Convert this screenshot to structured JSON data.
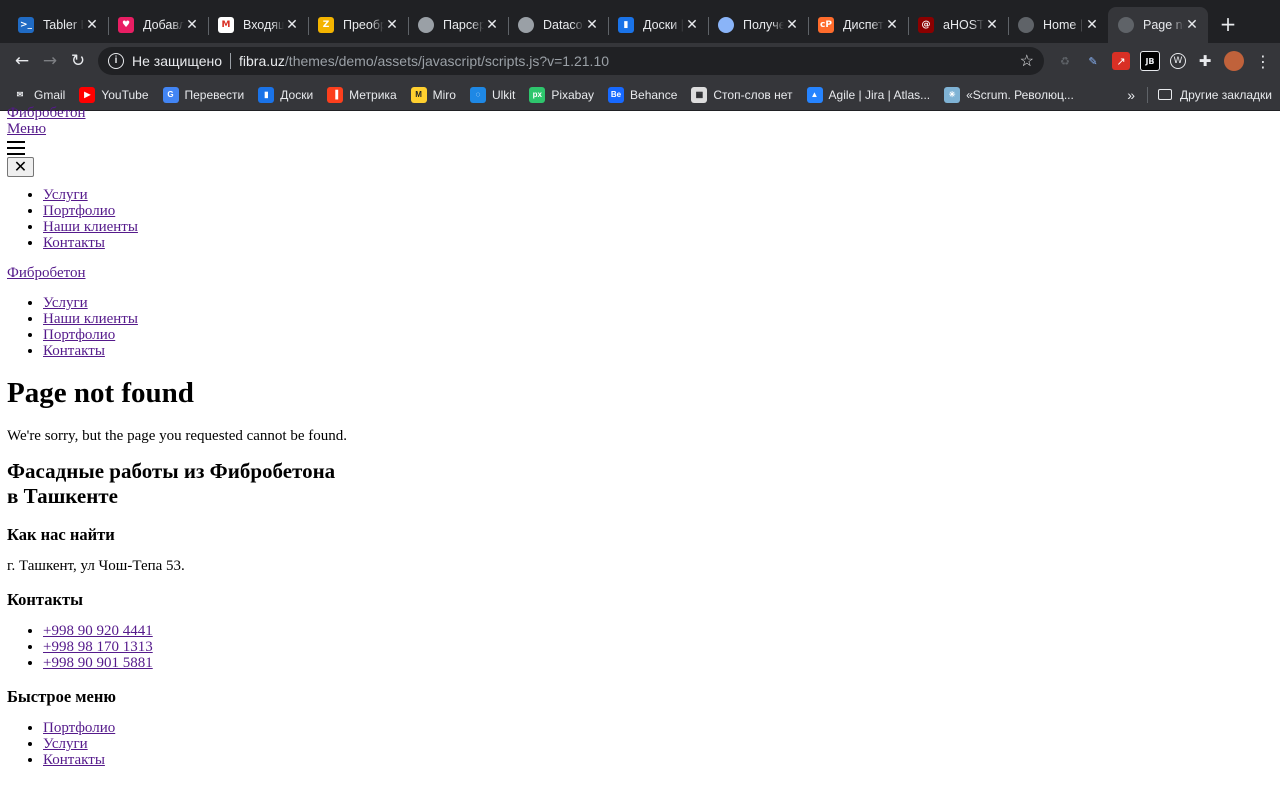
{
  "browser": {
    "tabs": [
      {
        "title": "Tabler Ic",
        "favicon": "tabler-icon",
        "color": "#206bc4",
        "glyph": ">_"
      },
      {
        "title": "Добавле",
        "favicon": "heart-icon",
        "color": "#e91e63",
        "glyph": "♥"
      },
      {
        "title": "Входящ",
        "favicon": "gmail-icon",
        "color": "#ffffff",
        "glyph": "M"
      },
      {
        "title": "Преобр",
        "favicon": "convert-icon",
        "color": "#f4b400",
        "glyph": "Z"
      },
      {
        "title": "Парсер",
        "favicon": "globe-icon",
        "color": "#9aa0a6",
        "glyph": ""
      },
      {
        "title": "Datacol",
        "favicon": "globe-icon",
        "color": "#9aa0a6",
        "glyph": ""
      },
      {
        "title": "Доски |",
        "favicon": "boards-icon",
        "color": "#1a73e8",
        "glyph": "▮"
      },
      {
        "title": "Получен",
        "favicon": "globe-icon",
        "color": "#8ab4f8",
        "glyph": ""
      },
      {
        "title": "Диспетч",
        "favicon": "cpanel-icon",
        "color": "#ff6c2c",
        "glyph": "cP"
      },
      {
        "title": "aHOST -",
        "favicon": "ahost-icon",
        "color": "#8b0000",
        "glyph": "@"
      },
      {
        "title": "Home |",
        "favicon": "globe-icon",
        "color": "#5f6368",
        "glyph": ""
      },
      {
        "title": "Page not",
        "favicon": "globe-icon",
        "color": "#5f6368",
        "glyph": "",
        "active": true
      }
    ],
    "security_label": "Не защищено",
    "url_host": "fibra.uz",
    "url_path": "/themes/demo/assets/javascript/scripts.js?v=1.21.10",
    "bookmarks": [
      {
        "label": "Gmail",
        "icon": "gmail-icon",
        "color": "#ffffff",
        "glyph": "✉"
      },
      {
        "label": "YouTube",
        "icon": "youtube-icon",
        "color": "#ff0000",
        "glyph": "▶"
      },
      {
        "label": "Перевести",
        "icon": "translate-icon",
        "color": "#4285f4",
        "glyph": "G"
      },
      {
        "label": "Доски",
        "icon": "boards-icon",
        "color": "#1a73e8",
        "glyph": "▮"
      },
      {
        "label": "Метрика",
        "icon": "metrika-icon",
        "color": "#fc3f1d",
        "glyph": "▐"
      },
      {
        "label": "Miro",
        "icon": "miro-icon",
        "color": "#ffd02f",
        "glyph": "M"
      },
      {
        "label": "Ulkit",
        "icon": "ulkit-icon",
        "color": "#1e88e5",
        "glyph": "◌"
      },
      {
        "label": "Pixabay",
        "icon": "pixabay-icon",
        "color": "#2ec66d",
        "glyph": "px"
      },
      {
        "label": "Behance",
        "icon": "behance-icon",
        "color": "#1769ff",
        "glyph": "Be"
      },
      {
        "label": "Стоп-слов нет",
        "icon": "grid-icon",
        "color": "#dddddd",
        "glyph": "▦"
      },
      {
        "label": "Agile | Jira | Atlas...",
        "icon": "atlassian-icon",
        "color": "#2684ff",
        "glyph": "▲"
      },
      {
        "label": "«Scrum. Революц...",
        "icon": "scrum-icon",
        "color": "#7fb3d5",
        "glyph": "✳"
      }
    ],
    "more_bookmarks": "»",
    "other_bookmarks": "Другие закладки"
  },
  "page": {
    "brand_link": "Фибробетон",
    "menu_link": "Меню",
    "close_glyph": "✕",
    "mobile_nav": [
      "Услуги",
      "Портфолио",
      "Наши клиенты",
      "Контакты"
    ],
    "brand_link_2": "Фибробетон",
    "main_nav": [
      "Услуги",
      "Наши клиенты",
      "Портфолио",
      "Контакты"
    ],
    "heading": "Page not found",
    "message": "We're sorry, but the page you requested cannot be found.",
    "footer_title_line1": "Фасадные работы из Фибробетона",
    "footer_title_line2": "в Ташкенте",
    "find_us_title": "Как нас найти",
    "address": "г. Ташкент, ул Чош-Тепа 53.",
    "contacts_title": "Контакты",
    "phones": [
      "+998 90 920 4441",
      "+998 98 170 1313",
      "+998 90 901 5881"
    ],
    "quick_menu_title": "Быстрое меню",
    "quick_menu": [
      "Портфолио",
      "Услуги",
      "Контакты"
    ]
  }
}
